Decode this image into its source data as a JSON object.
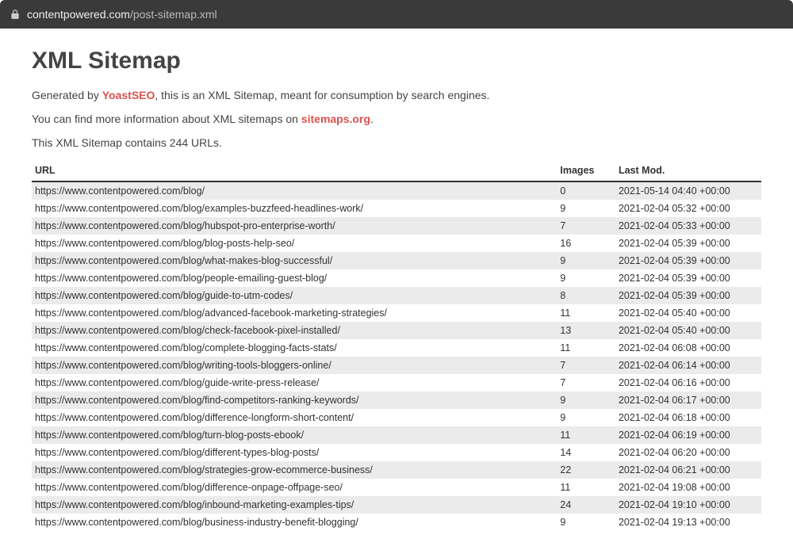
{
  "browser": {
    "domain": "contentpowered.com",
    "path": "/post-sitemap.xml"
  },
  "page": {
    "title": "XML Sitemap",
    "generated_prefix": "Generated by ",
    "generated_link": "YoastSEO",
    "generated_suffix": ", this is an XML Sitemap, meant for consumption by search engines.",
    "more_info_prefix": "You can find more information about XML sitemaps on ",
    "more_info_link": "sitemaps.org",
    "more_info_suffix": ".",
    "count_text": "This XML Sitemap contains 244 URLs."
  },
  "table": {
    "headers": {
      "url": "URL",
      "images": "Images",
      "lastmod": "Last Mod."
    },
    "rows": [
      {
        "url": "https://www.contentpowered.com/blog/",
        "images": "0",
        "lastmod": "2021-05-14 04:40 +00:00"
      },
      {
        "url": "https://www.contentpowered.com/blog/examples-buzzfeed-headlines-work/",
        "images": "9",
        "lastmod": "2021-02-04 05:32 +00:00"
      },
      {
        "url": "https://www.contentpowered.com/blog/hubspot-pro-enterprise-worth/",
        "images": "7",
        "lastmod": "2021-02-04 05:33 +00:00"
      },
      {
        "url": "https://www.contentpowered.com/blog/blog-posts-help-seo/",
        "images": "16",
        "lastmod": "2021-02-04 05:39 +00:00"
      },
      {
        "url": "https://www.contentpowered.com/blog/what-makes-blog-successful/",
        "images": "9",
        "lastmod": "2021-02-04 05:39 +00:00"
      },
      {
        "url": "https://www.contentpowered.com/blog/people-emailing-guest-blog/",
        "images": "9",
        "lastmod": "2021-02-04 05:39 +00:00"
      },
      {
        "url": "https://www.contentpowered.com/blog/guide-to-utm-codes/",
        "images": "8",
        "lastmod": "2021-02-04 05:39 +00:00"
      },
      {
        "url": "https://www.contentpowered.com/blog/advanced-facebook-marketing-strategies/",
        "images": "11",
        "lastmod": "2021-02-04 05:40 +00:00"
      },
      {
        "url": "https://www.contentpowered.com/blog/check-facebook-pixel-installed/",
        "images": "13",
        "lastmod": "2021-02-04 05:40 +00:00"
      },
      {
        "url": "https://www.contentpowered.com/blog/complete-blogging-facts-stats/",
        "images": "11",
        "lastmod": "2021-02-04 06:08 +00:00"
      },
      {
        "url": "https://www.contentpowered.com/blog/writing-tools-bloggers-online/",
        "images": "7",
        "lastmod": "2021-02-04 06:14 +00:00"
      },
      {
        "url": "https://www.contentpowered.com/blog/guide-write-press-release/",
        "images": "7",
        "lastmod": "2021-02-04 06:16 +00:00"
      },
      {
        "url": "https://www.contentpowered.com/blog/find-competitors-ranking-keywords/",
        "images": "9",
        "lastmod": "2021-02-04 06:17 +00:00"
      },
      {
        "url": "https://www.contentpowered.com/blog/difference-longform-short-content/",
        "images": "9",
        "lastmod": "2021-02-04 06:18 +00:00"
      },
      {
        "url": "https://www.contentpowered.com/blog/turn-blog-posts-ebook/",
        "images": "11",
        "lastmod": "2021-02-04 06:19 +00:00"
      },
      {
        "url": "https://www.contentpowered.com/blog/different-types-blog-posts/",
        "images": "14",
        "lastmod": "2021-02-04 06:20 +00:00"
      },
      {
        "url": "https://www.contentpowered.com/blog/strategies-grow-ecommerce-business/",
        "images": "22",
        "lastmod": "2021-02-04 06:21 +00:00"
      },
      {
        "url": "https://www.contentpowered.com/blog/difference-onpage-offpage-seo/",
        "images": "11",
        "lastmod": "2021-02-04 19:08 +00:00"
      },
      {
        "url": "https://www.contentpowered.com/blog/inbound-marketing-examples-tips/",
        "images": "24",
        "lastmod": "2021-02-04 19:10 +00:00"
      },
      {
        "url": "https://www.contentpowered.com/blog/business-industry-benefit-blogging/",
        "images": "9",
        "lastmod": "2021-02-04 19:13 +00:00"
      }
    ]
  }
}
